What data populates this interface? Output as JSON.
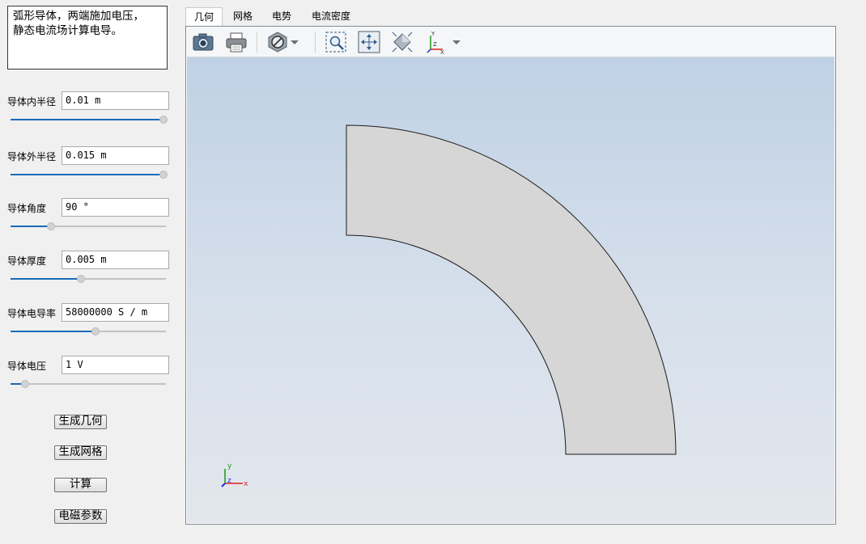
{
  "description": "弧形导体，两端施加电压，\n静态电流场计算电导。",
  "params": [
    {
      "label": "导体内半径",
      "value": "0.01 m",
      "slider": 1.0
    },
    {
      "label": "导体外半径",
      "value": "0.015 m",
      "slider": 1.0
    },
    {
      "label": "导体角度",
      "value": "90 °",
      "slider": 0.25
    },
    {
      "label": "导体厚度",
      "value": "0.005 m",
      "slider": 0.45
    },
    {
      "label": "导体电导率",
      "value": "58000000 S / m",
      "slider": 0.55
    },
    {
      "label": "导体电压",
      "value": "1 V",
      "slider": 0.08
    }
  ],
  "buttons": {
    "generate_geometry": "生成几何",
    "generate_mesh": "生成网格",
    "compute": "计算",
    "em_params": "电磁参数"
  },
  "tabs": [
    "几何",
    "网格",
    "电势",
    "电流密度"
  ],
  "active_tab": 0,
  "toolbar_icons": [
    "camera-icon",
    "print-icon",
    "display-mode-icon",
    "dropdown-arrow-icon",
    "zoom-box-icon",
    "zoom-extents-icon",
    "view-iso-icon",
    "axis-view-icon",
    "dropdown-arrow-icon"
  ],
  "triad": {
    "x": "x",
    "y": "y",
    "z": "z"
  },
  "colors": {
    "slider_fill": "#1a6bb8",
    "shape_fill": "#d6d6d6",
    "axis_x": "#e02020",
    "axis_y": "#1a9a1a",
    "axis_z": "#1a2ee0"
  }
}
